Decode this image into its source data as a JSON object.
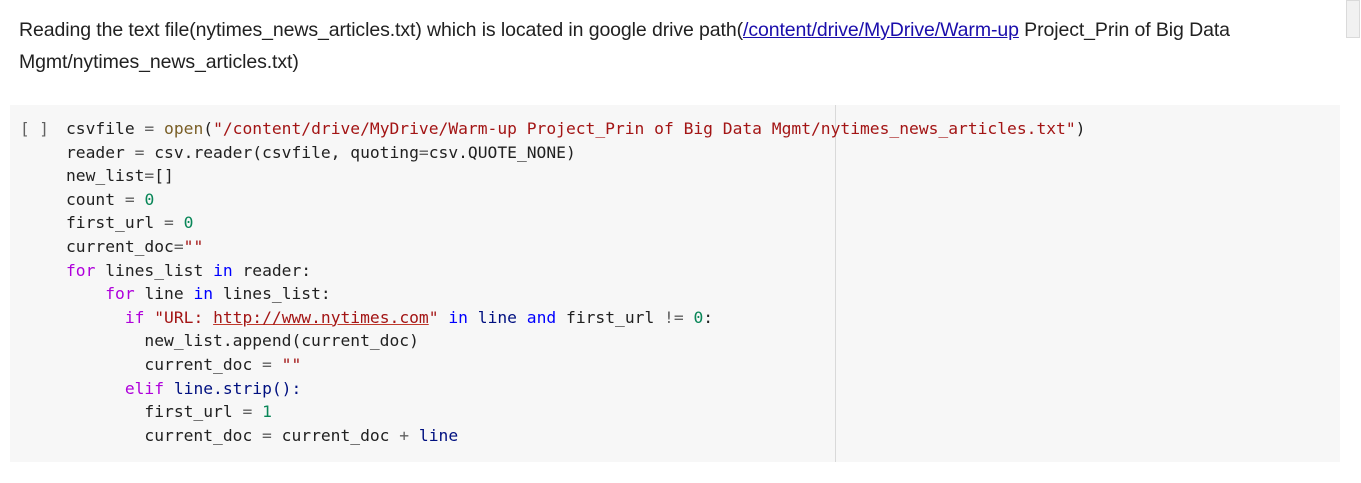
{
  "text_cell": {
    "before_link": "Reading the text file(nytimes_news_articles.txt) which is located in google drive path(",
    "link_text": "/content/drive/MyDrive/Warm-up",
    "after_link": " Project_Prin of Big Data Mgmt/nytimes_news_articles.txt)"
  },
  "code_cell": {
    "run_indicator": "[ ]",
    "lines": [
      [
        "csvfile ",
        "= ",
        "open",
        "(",
        "\"/content/drive/MyDrive/Warm-up Project_Prin of Big Data Mgmt/nytimes_news_articles.txt\"",
        ")"
      ],
      [
        "reader ",
        "= ",
        "csv.reader(csvfile, quoting",
        "=",
        "csv.QUOTE_NONE)"
      ],
      [
        "new_list",
        "=",
        "[]"
      ],
      [
        "count ",
        "= ",
        "0"
      ],
      [
        "first_url ",
        "= ",
        "0"
      ],
      [
        "current_doc",
        "=",
        "\"\""
      ],
      [
        "for",
        " lines_list ",
        "in",
        " reader:"
      ],
      [
        "    ",
        "for",
        " line ",
        "in",
        " lines_list:"
      ],
      [
        "      ",
        "if",
        " ",
        "\"URL: ",
        "http://www.nytimes.com",
        "\"",
        " ",
        "in",
        " line ",
        "and",
        " first_url ",
        "!= ",
        "0",
        ":"
      ],
      [
        "        new_list.append(current_doc)"
      ],
      [
        "        current_doc ",
        "= ",
        "\"\""
      ],
      [
        "      ",
        "elif",
        " line.strip():"
      ],
      [
        "        first_url ",
        "= ",
        "1"
      ],
      [
        "        current_doc ",
        "= ",
        "current_doc ",
        "+ ",
        "line"
      ]
    ]
  }
}
